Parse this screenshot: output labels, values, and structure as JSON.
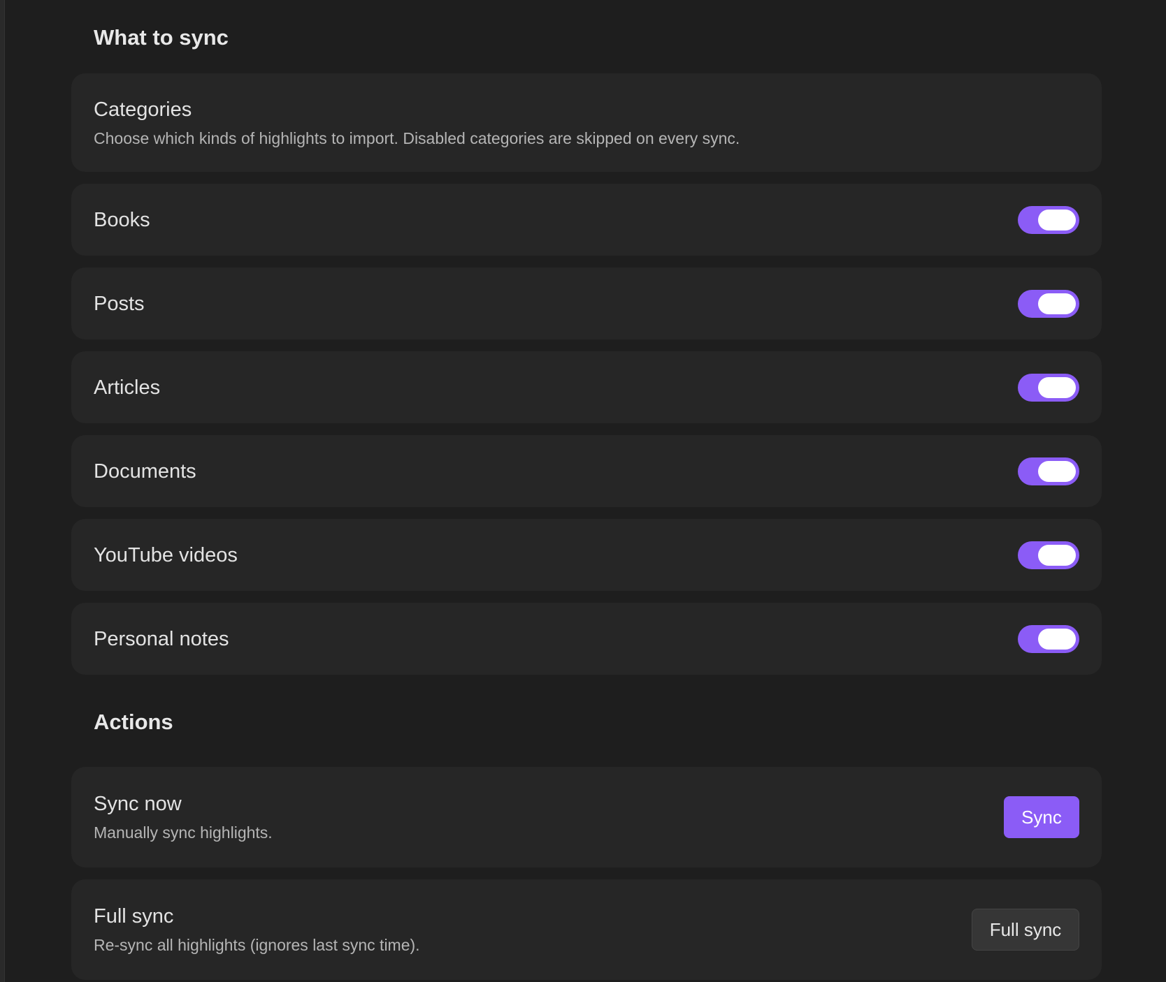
{
  "sections": {
    "what_to_sync": {
      "heading": "What to sync",
      "categories_title": "Categories",
      "categories_desc": "Choose which kinds of highlights to import. Disabled categories are skipped on every sync.",
      "items": [
        {
          "label": "Books",
          "enabled": true
        },
        {
          "label": "Posts",
          "enabled": true
        },
        {
          "label": "Articles",
          "enabled": true
        },
        {
          "label": "Documents",
          "enabled": true
        },
        {
          "label": "YouTube videos",
          "enabled": true
        },
        {
          "label": "Personal notes",
          "enabled": true
        }
      ]
    },
    "actions": {
      "heading": "Actions",
      "sync_now": {
        "title": "Sync now",
        "desc": "Manually sync highlights.",
        "button_label": "Sync"
      },
      "full_sync": {
        "title": "Full sync",
        "desc": "Re-sync all highlights (ignores last sync time).",
        "button_label": "Full sync"
      }
    }
  },
  "colors": {
    "accent": "#8b5cf6",
    "background": "#1e1e1e",
    "card": "#262626"
  }
}
